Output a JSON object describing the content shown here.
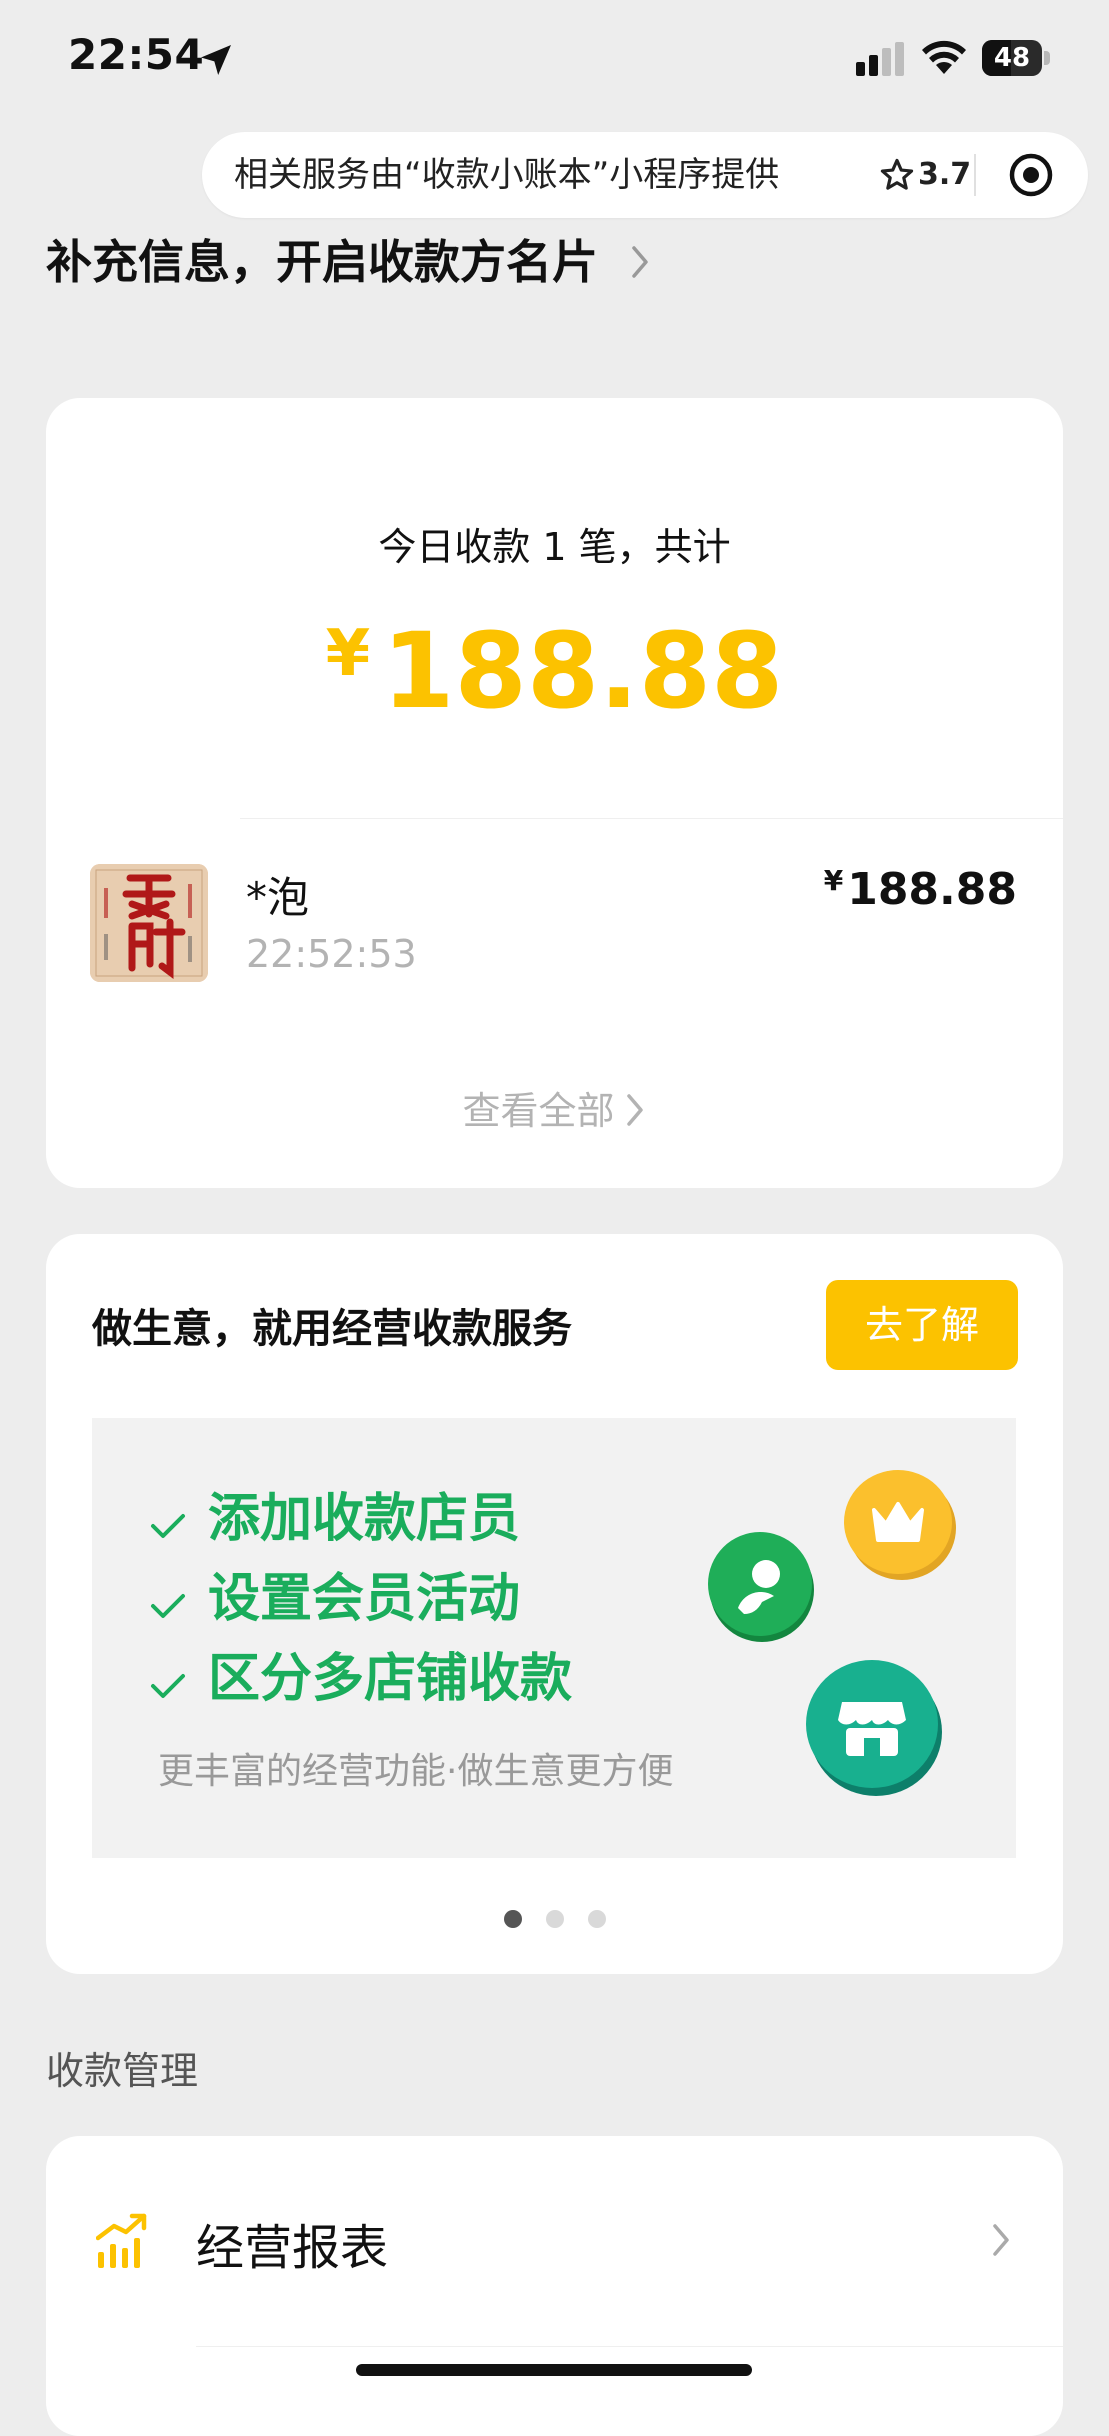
{
  "status_bar": {
    "time": "22:54",
    "battery_level": "48"
  },
  "capsule": {
    "provider_text": "相关服务由“收款小账本”小程序提供",
    "rating": "3.7"
  },
  "business_card_prompt": "补充信息，开启收款方名片",
  "today": {
    "summary": "今日收款 1 笔，共计",
    "currency": "¥",
    "total": "188.88",
    "view_all": "查看全部"
  },
  "transactions": [
    {
      "name": "*泡",
      "time": "22:52:53",
      "currency": "¥",
      "amount": "188.88"
    }
  ],
  "promo": {
    "title": "做生意，就用经营收款服务",
    "button": "去了解",
    "features": [
      "添加收款店员",
      "设置会员活动",
      "区分多店铺收款"
    ],
    "subtitle": "更丰富的经营功能·做生意更方便",
    "page_index": 1,
    "page_count": 3
  },
  "management": {
    "section_title": "收款管理",
    "items": [
      {
        "label": "经营报表",
        "icon": "bar-chart-icon"
      }
    ]
  },
  "colors": {
    "accent_yellow": "#fcc200",
    "brand_green": "#1aad5c",
    "teal": "#13a58a"
  }
}
